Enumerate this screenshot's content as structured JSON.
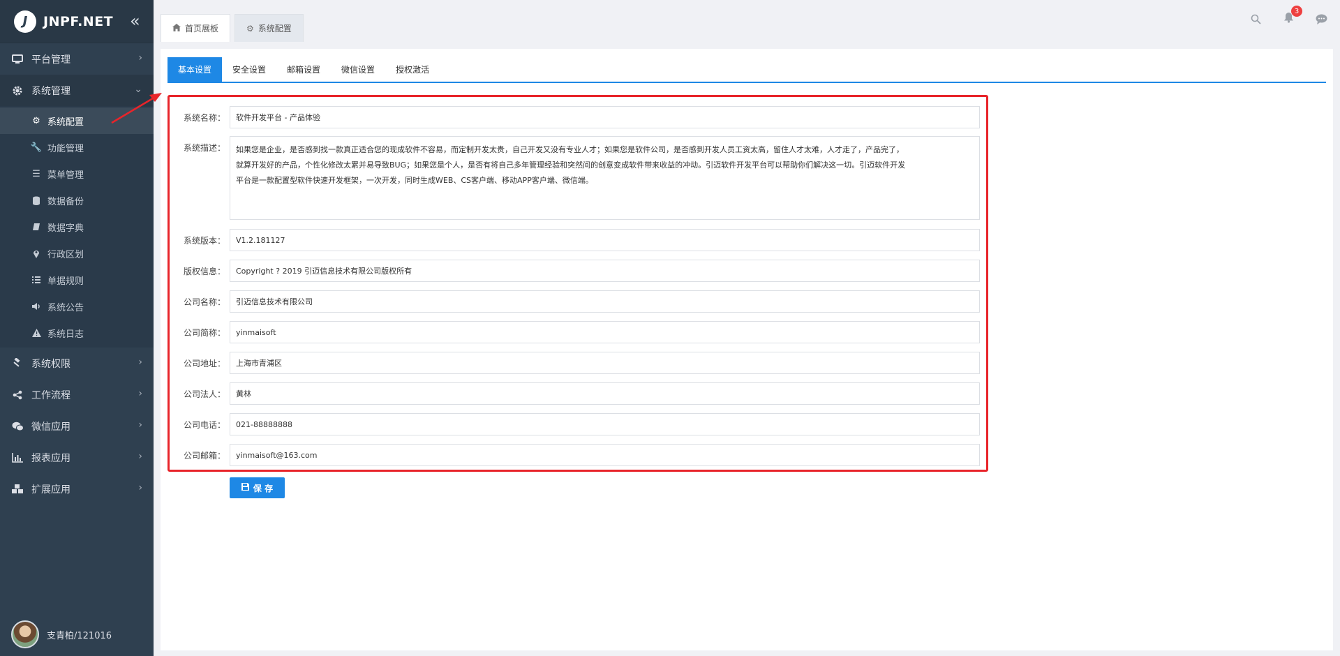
{
  "brand": {
    "mark": "J",
    "title": "JNPF.NET",
    "collapse_icon": "double-chevron-left-icon"
  },
  "sidebar": {
    "items": [
      {
        "label": "平台管理",
        "icon": "monitor-icon"
      },
      {
        "label": "系统管理",
        "icon": "gear-icon",
        "expanded": true,
        "children": [
          {
            "label": "系统配置",
            "icon": "gears-icon",
            "active": true
          },
          {
            "label": "功能管理",
            "icon": "wrench-icon"
          },
          {
            "label": "菜单管理",
            "icon": "menu-icon"
          },
          {
            "label": "数据备份",
            "icon": "database-icon"
          },
          {
            "label": "数据字典",
            "icon": "book-icon"
          },
          {
            "label": "行政区划",
            "icon": "map-marker-icon"
          },
          {
            "label": "单据规则",
            "icon": "list-ordered-icon"
          },
          {
            "label": "系统公告",
            "icon": "volume-icon"
          },
          {
            "label": "系统日志",
            "icon": "warning-icon"
          }
        ]
      },
      {
        "label": "系统权限",
        "icon": "gavel-icon"
      },
      {
        "label": "工作流程",
        "icon": "share-icon"
      },
      {
        "label": "微信应用",
        "icon": "wechat-icon"
      },
      {
        "label": "报表应用",
        "icon": "bar-chart-icon"
      },
      {
        "label": "扩展应用",
        "icon": "cubes-icon"
      }
    ]
  },
  "user": {
    "label": "支青柏/121016"
  },
  "page_tabs": [
    {
      "label": "首页展板",
      "icon": "home-icon"
    },
    {
      "label": "系统配置",
      "icon": "gears-icon",
      "active": true
    }
  ],
  "top_icons": {
    "search": "search-icon",
    "notifications": "bell-icon",
    "notification_count": "3",
    "messages": "comment-icon"
  },
  "sub_tabs": [
    {
      "label": "基本设置",
      "active": true
    },
    {
      "label": "安全设置"
    },
    {
      "label": "邮箱设置"
    },
    {
      "label": "微信设置"
    },
    {
      "label": "授权激活"
    }
  ],
  "form": {
    "system_name": {
      "label": "系统名称：",
      "value": "软件开发平台 - 产品体验"
    },
    "system_desc": {
      "label": "系统描述：",
      "lines": [
        "如果您是企业，是否感到找一款真正适合您的现成软件不容易，而定制开发太贵，自己开发又没有专业人才；如果您是软件公司，是否感到开发人员工资太高，留住人才太难，人才走了，产品完了，",
        "就算开发好的产品，个性化修改太累并易导致BUG；如果您是个人，是否有将自己多年管理经验和突然间的创意变成软件带来收益的冲动。引迈软件开发平台可以帮助你们解决这一切。引迈软件开发",
        "平台是一款配置型软件快速开发框架，一次开发，同时生成WEB、CS客户端、移动APP客户端、微信端。"
      ]
    },
    "system_version": {
      "label": "系统版本：",
      "value": "V1.2.181127"
    },
    "copyright": {
      "label": "版权信息：",
      "value": "Copyright ? 2019  引迈信息技术有限公司版权所有"
    },
    "company_name": {
      "label": "公司名称：",
      "value": "引迈信息技术有限公司"
    },
    "company_short": {
      "label": "公司简称：",
      "value": "yinmaisoft"
    },
    "company_address": {
      "label": "公司地址：",
      "value": "上海市青浦区"
    },
    "company_legal": {
      "label": "公司法人：",
      "value": "黄林"
    },
    "company_phone": {
      "label": "公司电话：",
      "value": "021-88888888"
    },
    "company_email": {
      "label": "公司邮箱：",
      "value": "yinmaisoft@163.com"
    }
  },
  "save_button": {
    "label": "保 存",
    "icon": "floppy-disk-icon"
  },
  "colors": {
    "sidebar": "#2f4050",
    "accent": "#1e88e5",
    "highlight": "#e8242a",
    "badge": "#ee4040"
  }
}
